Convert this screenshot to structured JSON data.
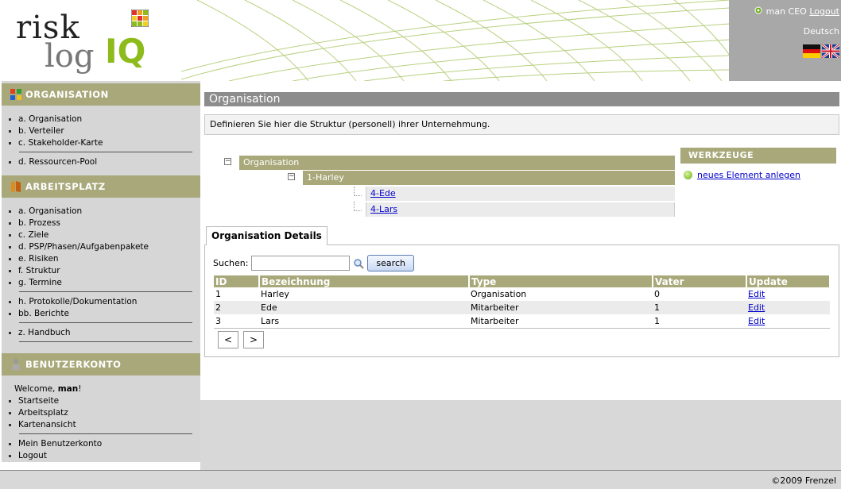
{
  "user_panel": {
    "user": "man CEO",
    "logout": "Logout",
    "language": "Deutsch"
  },
  "sidebar": {
    "section1": {
      "title": "ORGANISATION",
      "items": [
        "a. Organisation",
        "b. Verteiler",
        "c. Stakeholder-Karte",
        "d. Ressourcen-Pool"
      ]
    },
    "section2": {
      "title": "ARBEITSPLATZ",
      "items": [
        "a. Organisation",
        "b. Prozess",
        "c. Ziele",
        "d. PSP/Phasen/Aufgabenpakete",
        "e. Risiken",
        "f. Struktur",
        "g. Termine",
        "h. Protokolle/Dokumentation",
        "bb. Berichte",
        "z. Handbuch"
      ]
    },
    "section3": {
      "title": "BENUTZERKONTO",
      "welcome_prefix": "Welcome, ",
      "welcome_name": "man",
      "welcome_suffix": "!",
      "items": [
        "Startseite",
        "Arbeitsplatz",
        "Kartenansicht",
        "Mein Benutzerkonto",
        "Logout"
      ]
    }
  },
  "main": {
    "title": "Organisation",
    "description": "Definieren Sie hier die Struktur (personell) ihrer Unternehmung.",
    "tree": {
      "root": "Organisation",
      "child": "1-Harley",
      "leaves": [
        "4-Ede",
        "4-Lars"
      ]
    },
    "tools": {
      "title": "WERKZEUGE",
      "new_element": "neues Element anlegen"
    },
    "details": {
      "tab": "Organisation Details",
      "search_label": "Suchen:",
      "search_value": "",
      "search_button": "search",
      "columns": [
        "ID",
        "Bezeichnung",
        "Type",
        "Vater",
        "Update"
      ],
      "rows": [
        {
          "id": "1",
          "name": "Harley",
          "type": "Organisation",
          "parent": "0",
          "update": "Edit"
        },
        {
          "id": "2",
          "name": "Ede",
          "type": "Mitarbeiter",
          "parent": "1",
          "update": "Edit"
        },
        {
          "id": "3",
          "name": "Lars",
          "type": "Mitarbeiter",
          "parent": "1",
          "update": "Edit"
        }
      ],
      "prev": "<",
      "next": ">"
    }
  },
  "footer": {
    "copyright": "©2009 Frenzel"
  },
  "colors": {
    "accent": "#a8a87a",
    "title_bar": "#8c8c8c",
    "logo_green": "#8dbb1c"
  }
}
